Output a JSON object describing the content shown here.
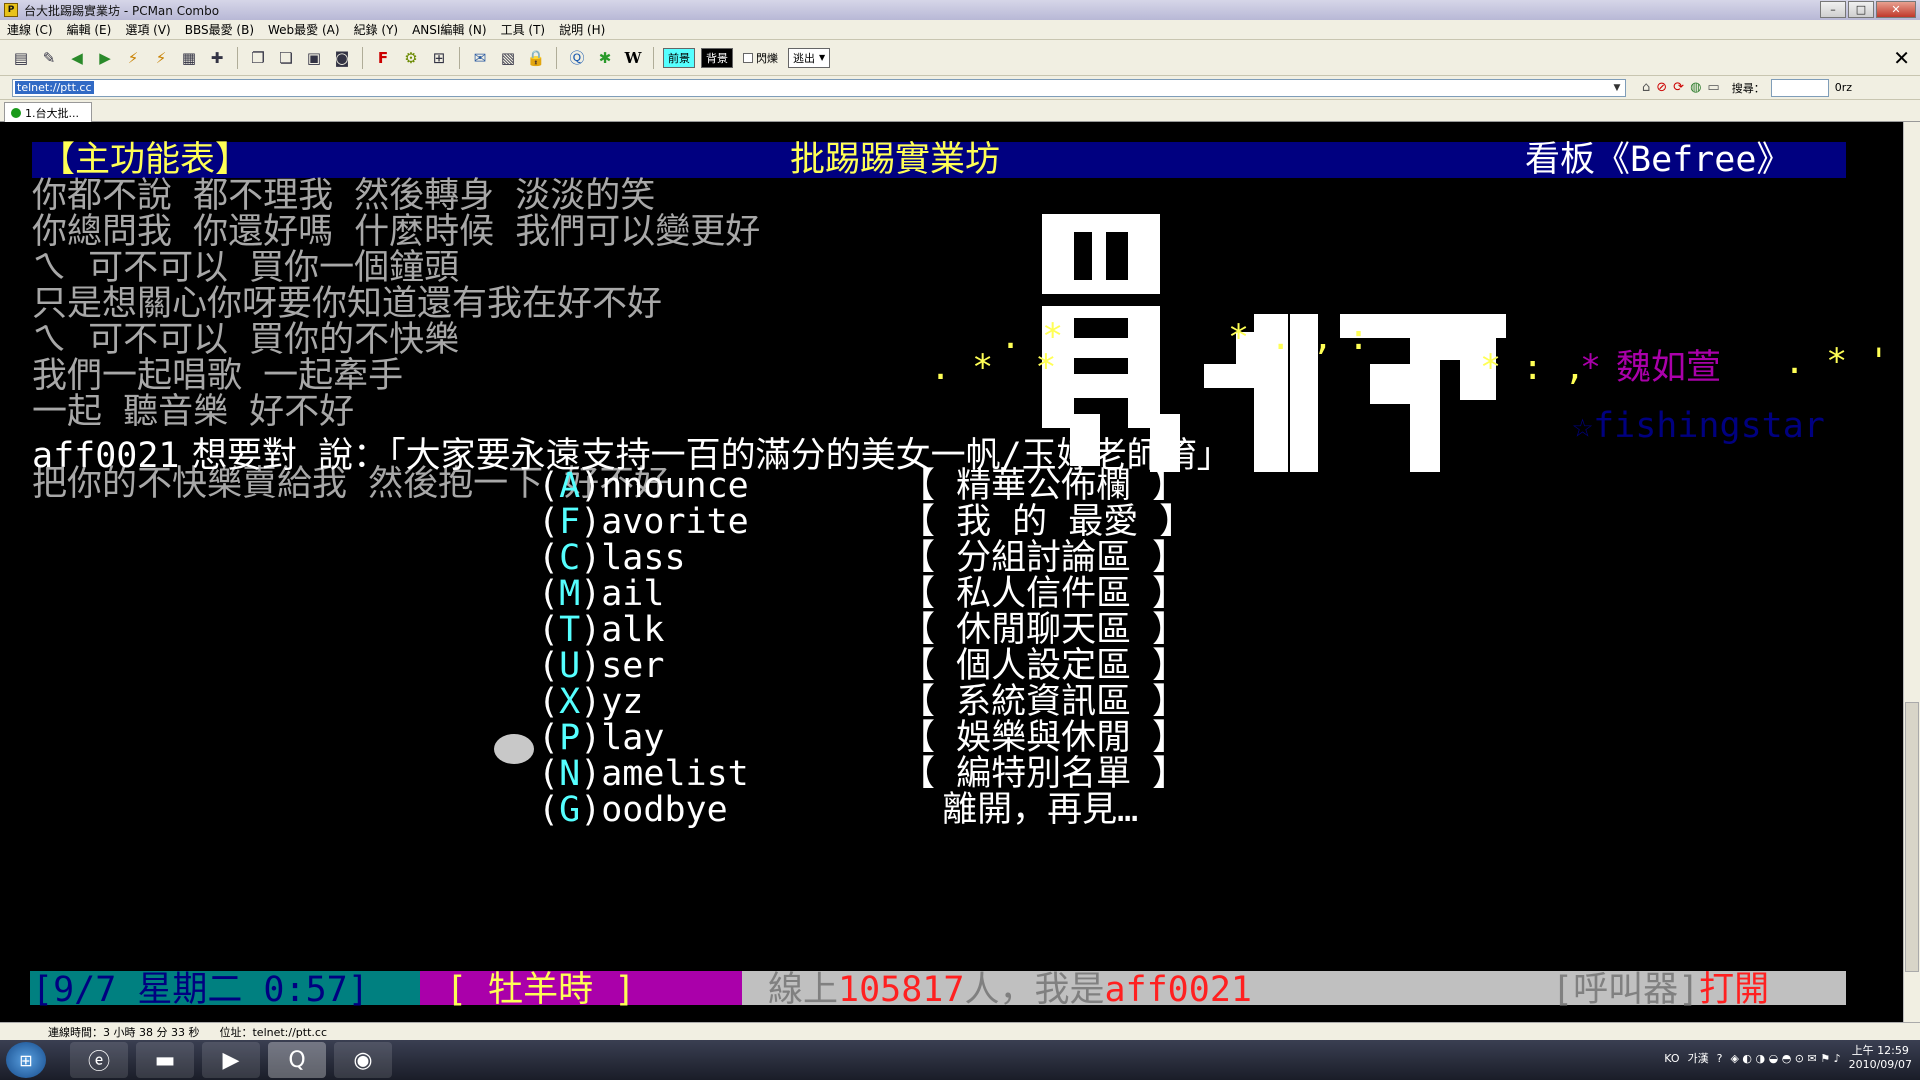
{
  "window": {
    "title": "台大批踢踢實業坊 - PCMan Combo",
    "app_icon": "pcman-icon",
    "controls": [
      "minimize",
      "maximize",
      "close"
    ]
  },
  "menubar": {
    "items": [
      "連線 (C)",
      "編輯 (E)",
      "選項 (V)",
      "BBS最愛 (B)",
      "Web最愛 (A)",
      "紀錄 (Y)",
      "ANSI編輯 (N)",
      "工具 (T)",
      "說明 (H)"
    ]
  },
  "toolbar": {
    "icons": [
      "new-window-icon",
      "new-tab-icon",
      "back-icon",
      "forward-icon",
      "reconnect-icon",
      "disconnect-icon",
      "copy-icon",
      "paste-icon",
      "settings-icon",
      "font-icon",
      "gear-icon",
      "fullscreen-icon",
      "mail-icon",
      "view-icon",
      "lock-icon",
      "bbs-icon",
      "asterisk-icon",
      "wikipedia-icon"
    ],
    "fg_label": "前景",
    "bg_label": "背景",
    "blink_label": "閃爍",
    "escape_label": "逃出"
  },
  "address": {
    "url": "telnet://ptt.cc",
    "search_label": "搜尋：",
    "search_engine": "0rz"
  },
  "tabs": [
    {
      "label": "1.台大批..."
    }
  ],
  "terminal": {
    "header_left": "【主功能表】",
    "header_center": "批踢踢實業坊",
    "header_right": "看板《Befree》",
    "lyrics": [
      "你都不說 都不理我 然後轉身 淡淡的笑",
      "你總問我 你還好嗎 什麼時候 我們可以變更好",
      "ㄟ 可不可以 買你一個鐘頭",
      "只是想關心你呀要你知道還有我在好不好",
      "ㄟ 可不可以 買你的不快樂",
      "我們一起唱歌 一起牽手",
      "一起 聽音樂 好不好",
      "",
      "把你的不快樂賣給我 然後抱一下 好不好"
    ],
    "art_sparkles_left": ". *  *",
    "art_sparkles_top": ". * ",
    "art_sparkles_mid": "* . ,",
    "art_sparkles_mid2": ":",
    "art_sparkles_right": "* : ,",
    "author_star": "*",
    "author_name": "魏如萱",
    "author_sparkle": ". * ' ,",
    "signature": "☆fishingstar",
    "say_user": "aff0021",
    "say_text": "想要對 說：「大家要永遠支持一百的滿分的美女一帆/玉婷老師唷」",
    "menu": [
      {
        "key": "A",
        "rest": "nnounce",
        "desc": "【 精華公佈欄 】"
      },
      {
        "key": "F",
        "rest": "avorite",
        "desc": "【 我 的 最愛 】"
      },
      {
        "key": "C",
        "rest": "lass",
        "desc": "【 分組討論區 】"
      },
      {
        "key": "M",
        "rest": "ail",
        "desc": "【 私人信件區 】"
      },
      {
        "key": "T",
        "rest": "alk",
        "desc": "【 休閒聊天區 】"
      },
      {
        "key": "U",
        "rest": "ser",
        "desc": "【 個人設定區 】"
      },
      {
        "key": "X",
        "rest": "yz",
        "desc": "【 系統資訊區 】"
      },
      {
        "key": "P",
        "rest": "lay",
        "desc": "【 娛樂與休閒 】"
      },
      {
        "key": "N",
        "rest": "amelist",
        "desc": "【 編特別名單 】"
      },
      {
        "key": "G",
        "rest": "oodbye",
        "desc": "  離開，再見…"
      }
    ],
    "status": {
      "datetime": "[9/7 星期二 0:57]",
      "zodiac": "[ 牡羊時 ]",
      "online_prefix": "線上",
      "online_count": "105817",
      "online_mid": "人，我是",
      "user": "aff0021",
      "pager_label": "[呼叫器]",
      "pager_state": "打開"
    }
  },
  "app_status": {
    "connection_time": "連線時間：3 小時 38 分 33 秒",
    "address": "位址：telnet://ptt.cc"
  },
  "taskbar": {
    "lang": "KO",
    "ime": "가漢",
    "time": "上午 12:59",
    "date": "2010/09/07"
  }
}
